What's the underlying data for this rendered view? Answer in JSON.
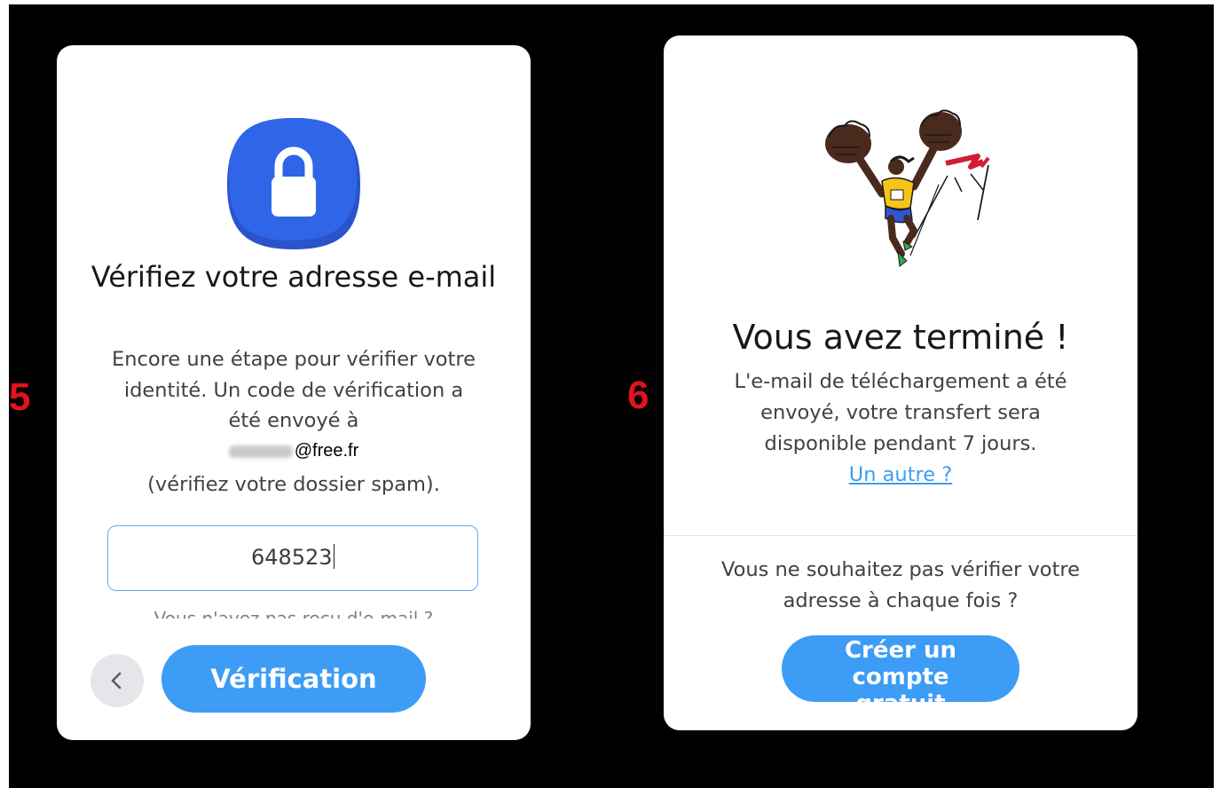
{
  "steps": {
    "left": "5",
    "right": "6"
  },
  "colors": {
    "accent": "#3d9cf5",
    "step_number": "#e3121b",
    "background": "#000000"
  },
  "card5": {
    "title": "Vérifiez votre adresse e-mail",
    "description": "Encore une étape pour vérifier votre identité. Un code de vérification a été envoyé à",
    "email_visible_part": "@free.fr",
    "spam_note": "(vérifiez votre dossier spam).",
    "code_value": "648523",
    "resend_text": "Vous n'avez pas reçu d'e-mail ?",
    "back_icon": "chevron-left-icon",
    "lock_icon": "lock-icon",
    "verify_button": "Vérification"
  },
  "card6": {
    "title": "Vous avez terminé !",
    "description": "L'e-mail de téléchargement a été envoyé, votre transfert sera disponible pendant 7 jours.",
    "another_link": "Un autre ?",
    "question": "Vous ne souhaitez pas vérifier votre adresse à chaque fois ?",
    "create_account_button": "Créer un compte gratuit",
    "illustration": "finish-line-runner-illustration"
  }
}
